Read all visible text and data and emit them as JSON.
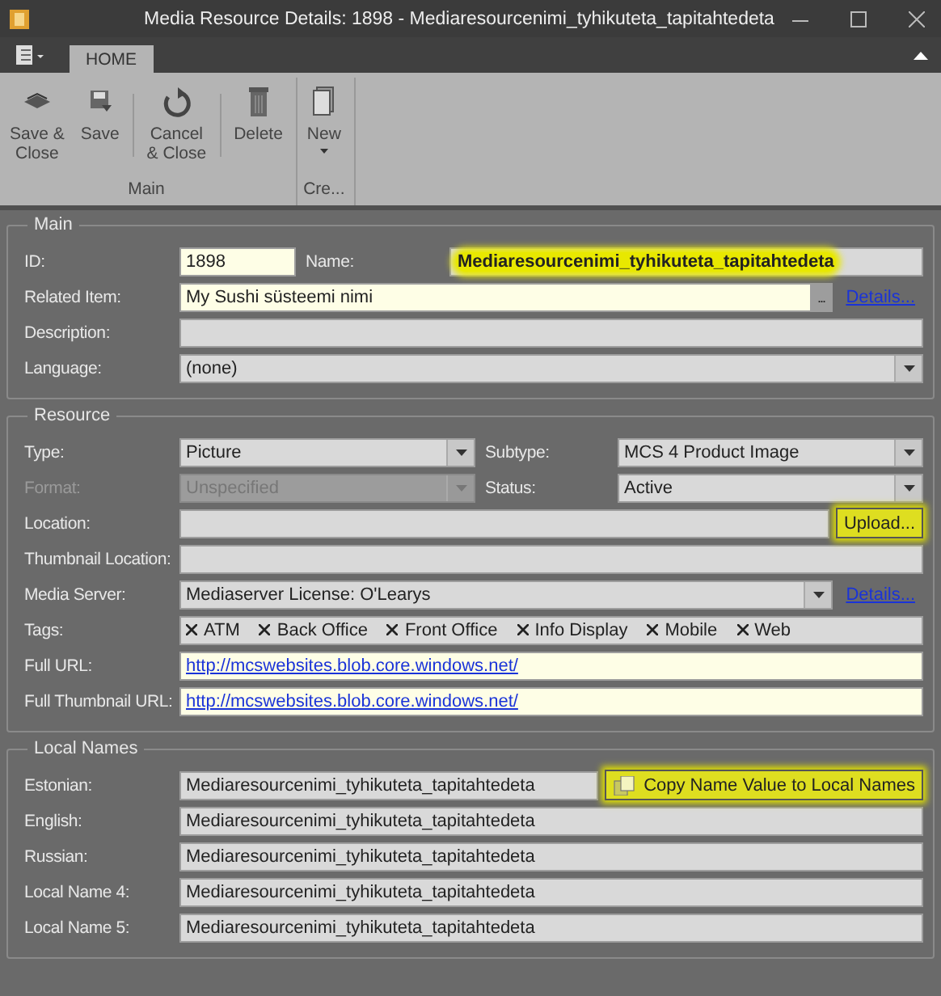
{
  "window": {
    "title": "Media Resource Details: 1898 - Mediaresourcenimi_tyhikuteta_tapitahtedeta"
  },
  "ribbon": {
    "tabs": [
      {
        "label": "HOME",
        "selected": true
      }
    ],
    "groups": [
      {
        "label": "Main",
        "buttons": [
          {
            "kind": "save-close",
            "label": "Save &\nClose"
          },
          {
            "kind": "save",
            "label": "Save"
          },
          {
            "kind": "separator"
          },
          {
            "kind": "cancel",
            "label": "Cancel\n& Close"
          },
          {
            "kind": "separator"
          },
          {
            "kind": "delete",
            "label": "Delete"
          }
        ]
      },
      {
        "label": "Cre...",
        "buttons": [
          {
            "kind": "new",
            "label": "New",
            "dropdown": true
          }
        ]
      }
    ]
  },
  "sections": [
    {
      "title": "Main",
      "rows": [
        {
          "kind": "id",
          "items": [
            {
              "kind": "label",
              "text": "ID:"
            },
            {
              "kind": "text",
              "value": "1898",
              "required": true
            },
            {
              "kind": "label",
              "text": "Name:"
            },
            {
              "kind": "text",
              "value": "Mediaresourcenimi_tyhikuteta_tapitahtedeta",
              "required": false,
              "bold": true,
              "highlighted": true
            }
          ]
        },
        {
          "kind": "action",
          "items": [
            {
              "kind": "label",
              "text": "Related Item:"
            },
            {
              "kind": "lookup",
              "value": "My Sushi süsteemi nimi",
              "button": "...",
              "required": true
            },
            {
              "kind": "link",
              "text": "Details..."
            }
          ]
        },
        {
          "kind": "single",
          "items": [
            {
              "kind": "label",
              "text": "Description:"
            },
            {
              "kind": "text",
              "value": "",
              "required": false
            }
          ]
        },
        {
          "kind": "single",
          "items": [
            {
              "kind": "label",
              "text": "Language:"
            },
            {
              "kind": "combo",
              "value": "(none)",
              "disabled": false
            }
          ]
        }
      ]
    },
    {
      "title": "Resource",
      "rows": [
        {
          "kind": "split",
          "items": [
            {
              "kind": "label",
              "text": "Type:",
              "disabled": false
            },
            {
              "kind": "combo",
              "value": "Picture",
              "disabled": false
            },
            {
              "kind": "label",
              "text": "Subtype:",
              "disabled": false
            },
            {
              "kind": "combo",
              "value": "MCS 4 Product Image",
              "disabled": false
            }
          ]
        },
        {
          "kind": "split",
          "items": [
            {
              "kind": "label",
              "text": "Format:",
              "disabled": true
            },
            {
              "kind": "combo",
              "value": "Unspecified",
              "disabled": true
            },
            {
              "kind": "label",
              "text": "Status:",
              "disabled": false
            },
            {
              "kind": "combo",
              "value": "Active",
              "disabled": false
            }
          ]
        },
        {
          "kind": "action",
          "items": [
            {
              "kind": "label",
              "text": "Location:"
            },
            {
              "kind": "text",
              "value": "",
              "required": false
            },
            {
              "kind": "button",
              "text": "Upload...",
              "highlighted": true
            }
          ]
        },
        {
          "kind": "single",
          "items": [
            {
              "kind": "label",
              "text": "Thumbnail Location:"
            },
            {
              "kind": "text",
              "value": "",
              "required": false
            }
          ]
        },
        {
          "kind": "action",
          "items": [
            {
              "kind": "label",
              "text": "Media Server:"
            },
            {
              "kind": "combo",
              "value": "Mediaserver License: O'Learys",
              "disabled": false
            },
            {
              "kind": "link",
              "text": "Details..."
            }
          ]
        },
        {
          "kind": "single",
          "items": [
            {
              "kind": "label",
              "text": "Tags:"
            },
            {
              "kind": "tags",
              "tags": [
                "ATM",
                "Back Office",
                "Front Office",
                "Info Display",
                "Mobile",
                "Web"
              ]
            }
          ]
        },
        {
          "kind": "single",
          "items": [
            {
              "kind": "label",
              "text": "Full URL:"
            },
            {
              "kind": "url",
              "value": "http://mcswebsites.blob.core.windows.net/"
            }
          ]
        },
        {
          "kind": "single",
          "items": [
            {
              "kind": "label",
              "text": "Full Thumbnail URL:"
            },
            {
              "kind": "url",
              "value": "http://mcswebsites.blob.core.windows.net/"
            }
          ]
        }
      ]
    },
    {
      "title": "Local Names",
      "rows": [
        {
          "kind": "action",
          "items": [
            {
              "kind": "label",
              "text": "Estonian:"
            },
            {
              "kind": "text",
              "value": "Mediaresourcenimi_tyhikuteta_tapitahtedeta",
              "required": false
            },
            {
              "kind": "button",
              "text": "Copy Name Value to Local Names",
              "icon": true,
              "highlighted": true
            }
          ]
        },
        {
          "kind": "single",
          "items": [
            {
              "kind": "label",
              "text": "English:"
            },
            {
              "kind": "text",
              "value": "Mediaresourcenimi_tyhikuteta_tapitahtedeta",
              "required": false
            }
          ]
        },
        {
          "kind": "single",
          "items": [
            {
              "kind": "label",
              "text": "Russian:"
            },
            {
              "kind": "text",
              "value": "Mediaresourcenimi_tyhikuteta_tapitahtedeta",
              "required": false
            }
          ]
        },
        {
          "kind": "single",
          "items": [
            {
              "kind": "label",
              "text": "Local Name 4:"
            },
            {
              "kind": "text",
              "value": "Mediaresourcenimi_tyhikuteta_tapitahtedeta",
              "required": false
            }
          ]
        },
        {
          "kind": "single",
          "items": [
            {
              "kind": "label",
              "text": "Local Name 5:"
            },
            {
              "kind": "text",
              "value": "Mediaresourcenimi_tyhikuteta_tapitahtedeta",
              "required": false
            }
          ]
        }
      ]
    }
  ]
}
